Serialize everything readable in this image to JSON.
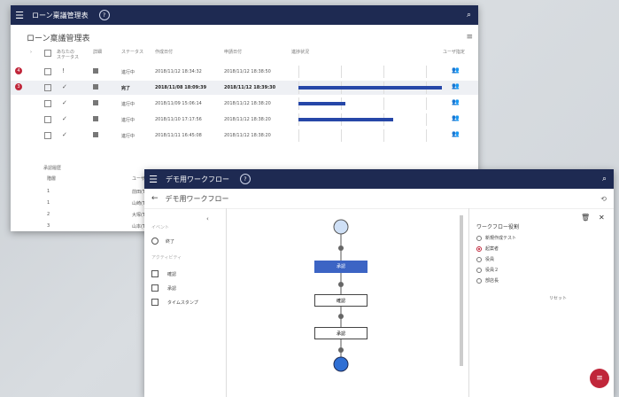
{
  "back": {
    "app_title": "ローン稟議管理表",
    "title": "ローン稟議管理表",
    "headers": [
      "あなたの\nステータス",
      "詳細",
      "ステータス",
      "作成日付",
      "申請日付",
      "進捗状況",
      "ユーザ指定"
    ],
    "rows": [
      {
        "badge": "4",
        "status": "進行中",
        "created": "2018/11/12 18:34:32",
        "applied": "2018/11/12 18:38:50",
        "progress": 0,
        "mark": "!"
      },
      {
        "badge": "3",
        "status": "完了",
        "created": "2018/11/08 18:09:39",
        "applied": "2018/11/12 18:39:30",
        "progress": 1.0,
        "mark": "✓",
        "selected": true
      },
      {
        "badge": "",
        "status": "進行中",
        "created": "2018/11/09 15:06:14",
        "applied": "2018/11/12 18:38:20",
        "progress": 0.33,
        "mark": "✓"
      },
      {
        "badge": "",
        "status": "進行中",
        "created": "2018/11/10 17:17:56",
        "applied": "2018/11/12 18:38:20",
        "progress": 0.66,
        "mark": "✓"
      },
      {
        "badge": "",
        "status": "進行中",
        "created": "2018/11/11 16:45:08",
        "applied": "2018/11/12 18:38:20",
        "progress": 0,
        "mark": "✓"
      }
    ],
    "history": {
      "label": "承認履歴",
      "col": "階層",
      "col2": "ユーザ",
      "rows": [
        {
          "n": "1",
          "user": "前田(T"
        },
        {
          "n": "1",
          "user": "山崎(T"
        },
        {
          "n": "2",
          "user": "大塚(T"
        },
        {
          "n": "3",
          "user": "山本(T"
        }
      ]
    }
  },
  "front": {
    "app_title": "デモ用ワークフロー",
    "title": "デモ用ワークフロー",
    "left": {
      "sec1": "イベント",
      "end": "終了",
      "sec2": "アクティビティ",
      "act1": "確認",
      "act2": "承認",
      "act3": "タイムスタンプ"
    },
    "nodes": {
      "a": "承認",
      "b": "確認",
      "c": "承認"
    },
    "role_panel": {
      "title": "ワークフロー役割",
      "options": [
        {
          "label": "新規作成テスト",
          "on": false
        },
        {
          "label": "起案者",
          "on": true
        },
        {
          "label": "役員",
          "on": false
        },
        {
          "label": "役員２",
          "on": false
        },
        {
          "label": "部店長",
          "on": false
        }
      ],
      "reset": "リセット"
    }
  },
  "colors": {
    "navy": "#1e2a52",
    "accent": "#2647a8",
    "red": "#c0263a"
  }
}
